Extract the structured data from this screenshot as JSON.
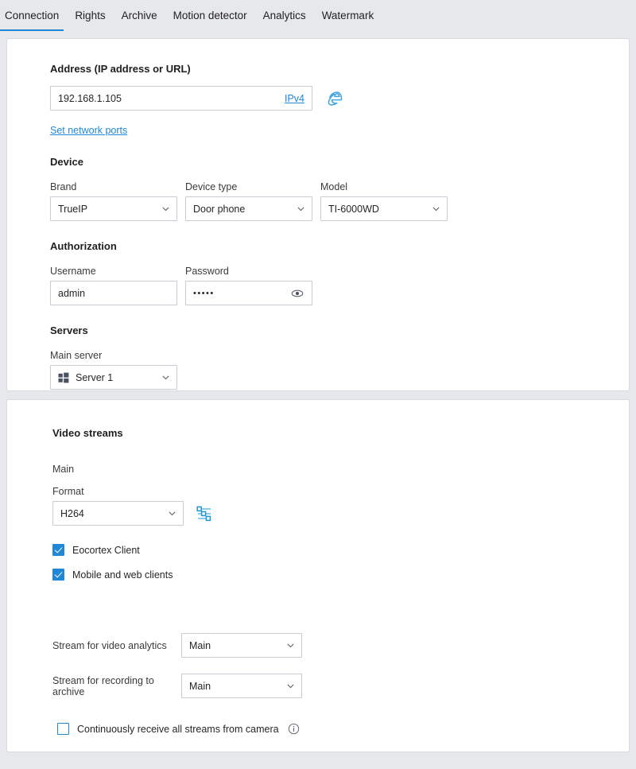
{
  "tabs": [
    {
      "label": "Connection",
      "active": true
    },
    {
      "label": "Rights",
      "active": false
    },
    {
      "label": "Archive",
      "active": false
    },
    {
      "label": "Motion detector",
      "active": false
    },
    {
      "label": "Analytics",
      "active": false
    },
    {
      "label": "Watermark",
      "active": false
    }
  ],
  "connection": {
    "address": {
      "title": "Address (IP address or URL)",
      "value": "192.168.1.105",
      "ip_version_link": "IPv4",
      "browser_icon": "internet-explorer-icon",
      "network_ports_link": "Set network ports"
    },
    "device": {
      "title": "Device",
      "brand_label": "Brand",
      "brand_value": "TrueIP",
      "device_type_label": "Device type",
      "device_type_value": "Door phone",
      "model_label": "Model",
      "model_value": "TI-6000WD"
    },
    "authorization": {
      "title": "Authorization",
      "username_label": "Username",
      "username_value": "admin",
      "password_label": "Password",
      "password_value": "•••••",
      "reveal_icon": "eye-icon"
    },
    "servers": {
      "title": "Servers",
      "main_server_label": "Main server",
      "main_server_value": "Server 1",
      "server_icon": "grid-icon"
    }
  },
  "video_streams": {
    "title": "Video streams",
    "main_label": "Main",
    "format_label": "Format",
    "format_value": "H264",
    "format_settings_icon": "sliders-icon",
    "checkboxes": [
      {
        "label": "Eocortex Client",
        "checked": true
      },
      {
        "label": "Mobile and web clients",
        "checked": true
      }
    ],
    "analytics_stream_label": "Stream for video analytics",
    "analytics_stream_value": "Main",
    "archive_stream_label": "Stream for recording to archive",
    "archive_stream_value": "Main",
    "continuous": {
      "label": "Continuously receive all streams from camera",
      "checked": false,
      "info_icon": "info-icon"
    }
  },
  "colors": {
    "accent": "#1f87d6",
    "background": "#e6e8ec",
    "card": "#ffffff",
    "border": "#d7dae0",
    "input_border": "#c8ccd4",
    "text": "#262626"
  }
}
